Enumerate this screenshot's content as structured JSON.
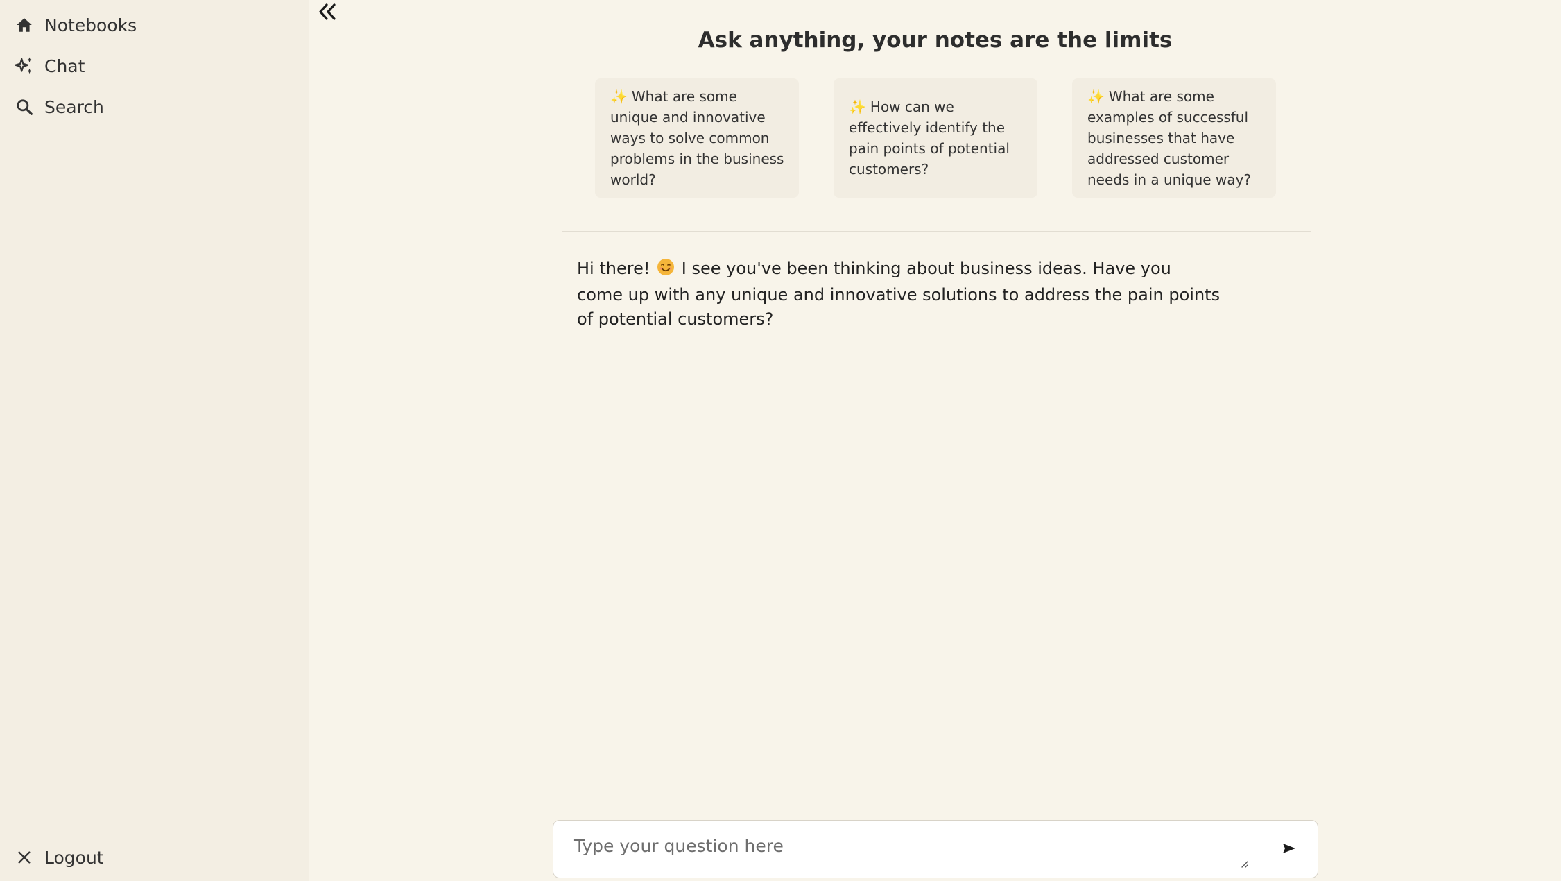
{
  "sidebar": {
    "items": [
      {
        "label": "Notebooks",
        "icon": "home-icon"
      },
      {
        "label": "Chat",
        "icon": "sparkles-icon"
      },
      {
        "label": "Search",
        "icon": "search-icon"
      }
    ],
    "logout": {
      "label": "Logout",
      "icon": "close-icon"
    }
  },
  "main": {
    "title": "Ask anything, your notes are the limits",
    "suggestions": [
      {
        "emoji": "✨",
        "text": "What are some unique and innovative ways to solve common problems in the business world?"
      },
      {
        "emoji": "✨",
        "text": "How can we effectively identify the pain points of potential customers?"
      },
      {
        "emoji": "✨",
        "text": "What are some examples of successful businesses that have addressed customer needs in a unique way?"
      }
    ],
    "message": {
      "before_emoji": "Hi there!",
      "emoji": "😊",
      "after_emoji": "I see you've been thinking about business ideas. Have you come up with any unique and innovative solutions to address the pain points of potential customers?"
    }
  },
  "composer": {
    "placeholder": "Type your question here",
    "value": ""
  },
  "colors": {
    "background": "#f8f4ea",
    "sidebar": "#f3eee3",
    "card": "#f2ede2",
    "text": "#2a2a2a"
  }
}
